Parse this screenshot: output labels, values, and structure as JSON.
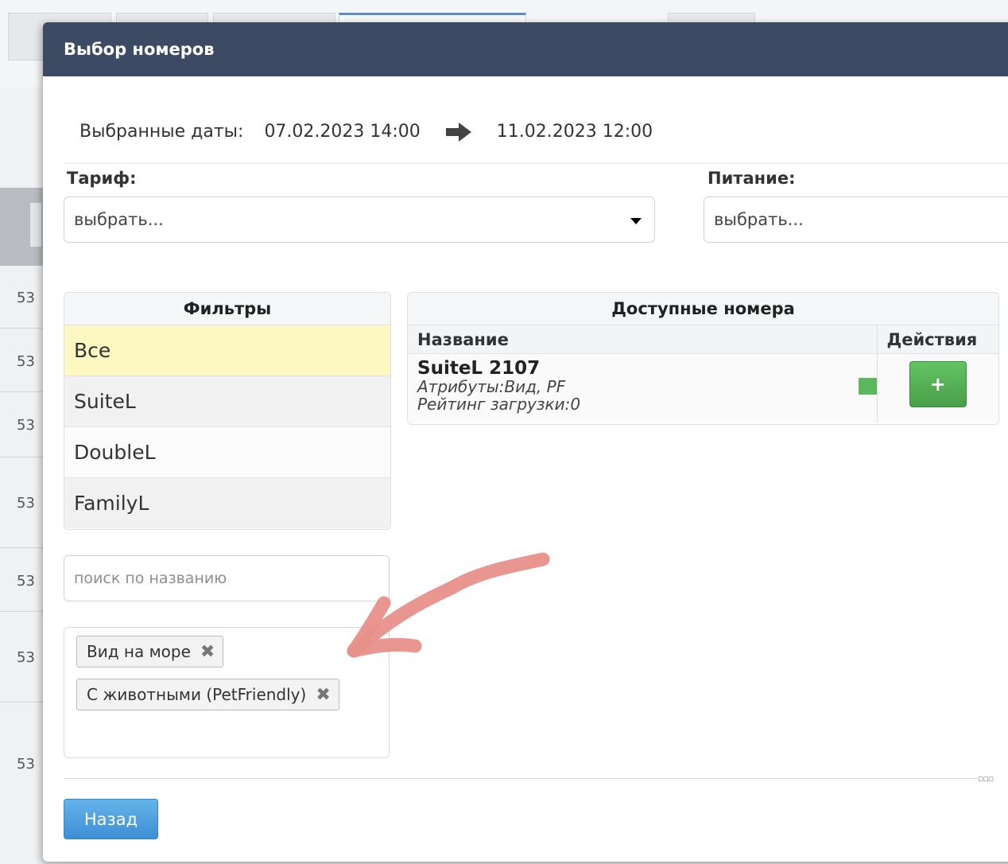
{
  "modal": {
    "title": "Выбор номеров"
  },
  "dates": {
    "label": "Выбранные даты:",
    "from": "07.02.2023 14:00",
    "to": "11.02.2023 12:00"
  },
  "tariff": {
    "label": "Тариф:",
    "value": "выбрать..."
  },
  "meal": {
    "label": "Питание:",
    "value": "выбрать..."
  },
  "filters": {
    "title": "Фильтры",
    "items": [
      "Все",
      "SuiteL",
      "DoubleL",
      "FamilyL"
    ]
  },
  "search": {
    "placeholder": "поиск по названию"
  },
  "tags": [
    "Вид на море",
    "С животными (PetFriendly)"
  ],
  "rooms": {
    "title": "Доступные номера",
    "columns": [
      "Название",
      "Действия"
    ],
    "items": [
      {
        "name": "SuiteL 2107",
        "attributes": "Атрибуты:Вид, PF",
        "rating": "Рейтинг загрузки:0",
        "status_color": "#5cb85c",
        "action_label": "+"
      }
    ]
  },
  "footer": {
    "back_label": "Назад"
  },
  "background": {
    "row_numbers": [
      "53",
      "53",
      "53",
      "53",
      "53",
      "53",
      "53"
    ]
  },
  "colors": {
    "header": "#3d4a63",
    "selected_filter": "#fdf8c1",
    "add_button": "#51a351",
    "back_button": "#3d8fd4",
    "annotation_arrow": "#e8908b"
  }
}
